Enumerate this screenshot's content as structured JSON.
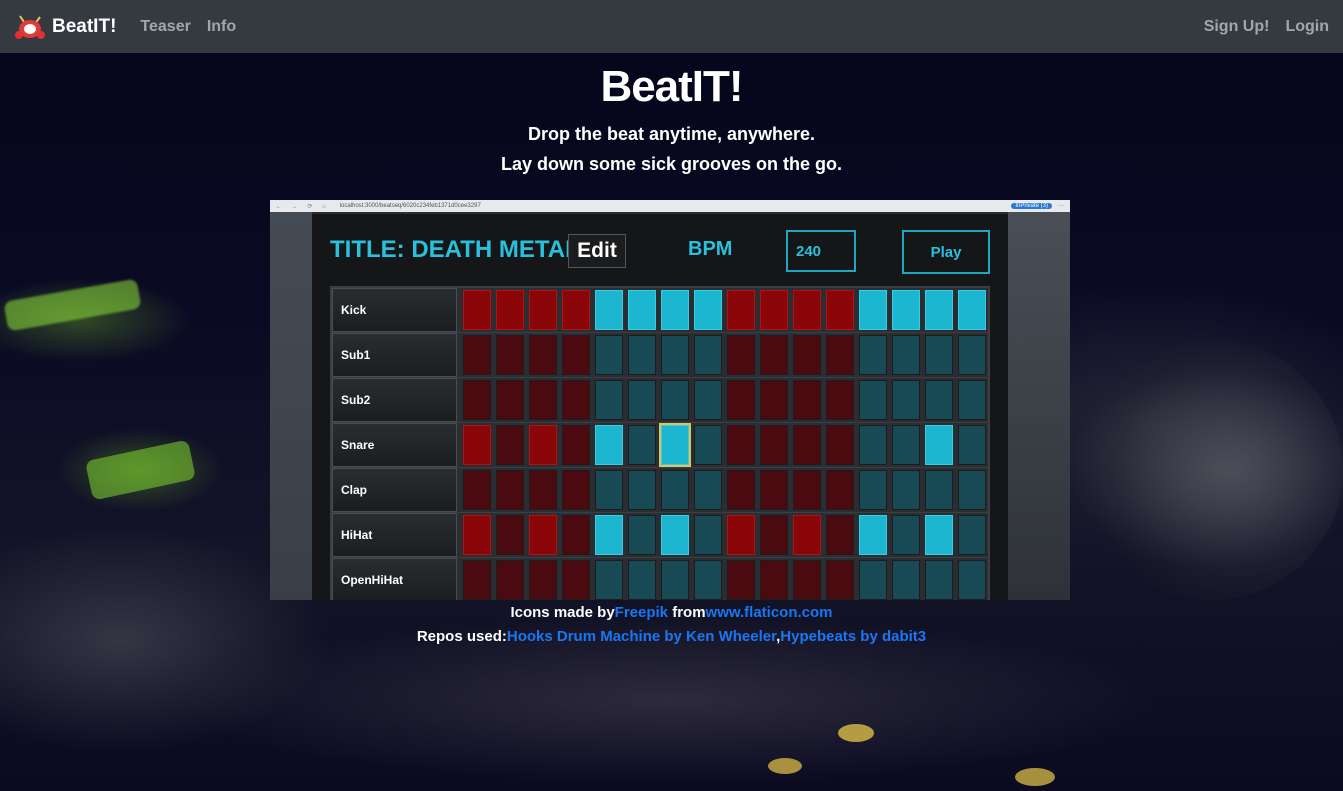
{
  "navbar": {
    "brand": "BeatIT!",
    "links": [
      "Teaser",
      "Info"
    ],
    "right_links": [
      "Sign Up!",
      "Login"
    ]
  },
  "hero": {
    "title": "BeatIT!",
    "tagline_1": "Drop the beat anytime, anywhere.",
    "tagline_2": "Lay down some sick grooves on the go."
  },
  "preview": {
    "browser_url": "localhost:3000/beatseq/6020c234feb1371d0cee3297",
    "browser_badge": "InPrivate (3)",
    "app_title": "TITLE: DEATH METAL",
    "edit_label": "Edit",
    "bpm_label": "BPM",
    "bpm_value": "240",
    "play_label": "Play",
    "tracks": [
      {
        "name": "Kick",
        "steps": [
          1,
          1,
          1,
          1,
          1,
          1,
          1,
          1,
          1,
          1,
          1,
          1,
          1,
          1,
          1,
          1
        ]
      },
      {
        "name": "Sub1",
        "steps": [
          0,
          0,
          0,
          0,
          0,
          0,
          0,
          0,
          0,
          0,
          0,
          0,
          0,
          0,
          0,
          0
        ]
      },
      {
        "name": "Sub2",
        "steps": [
          0,
          0,
          0,
          0,
          0,
          0,
          0,
          0,
          0,
          0,
          0,
          0,
          0,
          0,
          0,
          0
        ]
      },
      {
        "name": "Snare",
        "steps": [
          1,
          0,
          1,
          0,
          1,
          0,
          1,
          0,
          0,
          0,
          0,
          0,
          0,
          0,
          1,
          0
        ]
      },
      {
        "name": "Clap",
        "steps": [
          0,
          0,
          0,
          0,
          0,
          0,
          0,
          0,
          0,
          0,
          0,
          0,
          0,
          0,
          0,
          0
        ]
      },
      {
        "name": "HiHat",
        "steps": [
          1,
          0,
          1,
          0,
          1,
          0,
          1,
          0,
          1,
          0,
          1,
          0,
          1,
          0,
          1,
          0
        ]
      },
      {
        "name": "OpenHiHat",
        "steps": [
          0,
          0,
          0,
          0,
          0,
          0,
          0,
          0,
          0,
          0,
          0,
          0,
          0,
          0,
          0,
          0
        ]
      }
    ],
    "selected_cell": {
      "track": 3,
      "step": 6
    }
  },
  "credits": {
    "icons_prefix": "Icons made by",
    "freepik": "Freepik",
    "from": "from",
    "flaticon": "www.flaticon.com",
    "repos_prefix": "Repos used:",
    "repo_1": "Hooks Drum Machine by Ken Wheeler",
    "comma": ",",
    "repo_2": "Hypebeats by dabit3"
  },
  "colors": {
    "navbar": "#343a40",
    "accent_cyan": "#2ac0dd",
    "link_blue": "#1877f2",
    "step_red": "#8a0508",
    "step_blue": "#1cb6d1"
  }
}
